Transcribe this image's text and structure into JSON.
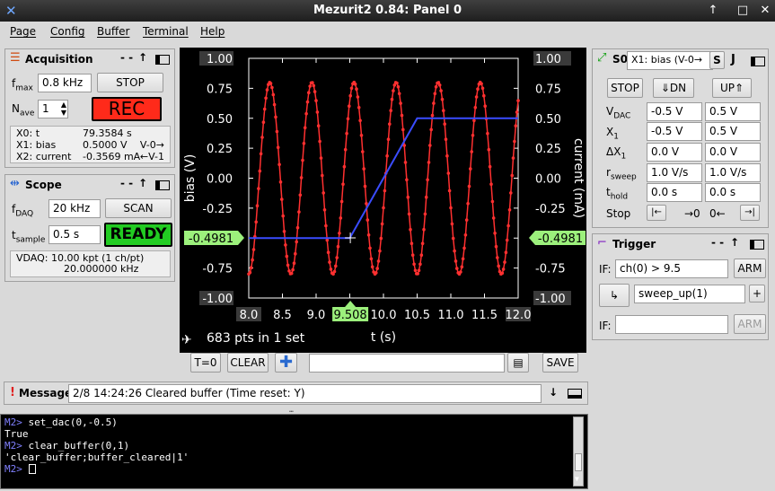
{
  "window": {
    "title": "Mezurit2 0.84: Panel 0",
    "controls": [
      "↑",
      "□",
      "✕"
    ]
  },
  "menu": [
    "Page",
    "Config",
    "Buffer",
    "Terminal",
    "Help"
  ],
  "acquisition": {
    "title": "Acquisition",
    "fmax_label": "f",
    "fmax_sub": "max",
    "fmax_value": "0.8 kHz",
    "stop_label": "STOP",
    "nave_label": "N",
    "nave_sub": "ave",
    "nave_value": "1",
    "rec_label": "REC",
    "info": [
      {
        "name": "X0: t",
        "value": "79.3584 s",
        "extra": ""
      },
      {
        "name": "X1: bias",
        "value": "0.5000 V",
        "extra": "V-0→"
      },
      {
        "name": "X2: current",
        "value": "-0.3569 mA",
        "extra": "←V-1"
      }
    ]
  },
  "scope": {
    "title": "Scope",
    "fdaq_label": "f",
    "fdaq_sub": "DAQ",
    "fdaq_value": "20 kHz",
    "scan_label": "SCAN",
    "tsample_label": "t",
    "tsample_sub": "sample",
    "tsample_value": "0.5 s",
    "ready_label": "READY",
    "info_line1": "VDAQ: 10.00 kpt (1 ch/pt)",
    "info_line2": "20.000000 kHz"
  },
  "plot": {
    "ylabel_left": "bias (V)",
    "ylabel_right": "current (mA)",
    "xlabel": "t (s)",
    "left_marker": "-0.4981",
    "right_marker": "-0.4981",
    "x_marker": "9.508",
    "status": "683 pts in 1 set",
    "colors": {
      "bias": "#ff3030",
      "current": "#3a4cff",
      "marker": "#9cf07c"
    }
  },
  "chart_data": {
    "type": "line",
    "x_ticks": [
      "8.0",
      "8.5",
      "9.0",
      "9.5",
      "10.0",
      "10.5",
      "11.0",
      "11.5",
      "12.0"
    ],
    "y_ticks": [
      "1.00",
      "0.75",
      "0.50",
      "0.25",
      "0.00",
      "-0.25",
      "-0.50",
      "-0.75",
      "-1.00"
    ],
    "xlim": [
      8.0,
      12.0
    ],
    "ylim": [
      -1.0,
      1.0
    ],
    "series": [
      {
        "name": "bias",
        "style": "dotted-sine",
        "amplitude": 0.8,
        "period": 0.625,
        "phase_x": 8.0,
        "points": 683
      },
      {
        "name": "current",
        "x": [
          8.0,
          9.5,
          10.5,
          12.0
        ],
        "y": [
          -0.5,
          -0.5,
          0.5,
          0.5
        ]
      }
    ]
  },
  "plot_buttons": {
    "t0": "T=0",
    "clear": "CLEAR",
    "save": "SAVE"
  },
  "message": {
    "label": "Message",
    "text": "2/8 14:24:26  Cleared buffer (Time reset: Y)"
  },
  "terminal": [
    {
      "prompt": "M2>",
      "text": " set_dac(0,-0.5)"
    },
    {
      "prompt": "",
      "text": "True"
    },
    {
      "prompt": "M2>",
      "text": " clear_buffer(0,1)"
    },
    {
      "prompt": "",
      "text": "'clear_buffer;buffer_cleared|1'"
    },
    {
      "prompt": "M2>",
      "text": " "
    }
  ],
  "sweep": {
    "title": "S0",
    "channel": "X1: bias (V-0→",
    "s_label": "S",
    "j_label": "J",
    "stop_label": "STOP",
    "dn_label": "DN",
    "up_label": "UP",
    "rows": [
      {
        "label": "V",
        "sub": "DAC",
        "a": "-0.5 V",
        "b": "0.5 V"
      },
      {
        "label": "X",
        "sub": "1",
        "a": "-0.5 V",
        "b": "0.5 V"
      },
      {
        "label": "ΔX",
        "sub": "1",
        "a": "0.0 V",
        "b": "0.0 V"
      },
      {
        "label": "r",
        "sub": "sweep",
        "a": "1.0 V/s",
        "b": "1.0 V/s"
      },
      {
        "label": "t",
        "sub": "hold",
        "a": "0.0 s",
        "b": "0.0 s"
      }
    ],
    "stop_row_label": "Stop",
    "stop_arrow1": "→0",
    "stop_arrow2": "0←"
  },
  "trigger": {
    "title": "Trigger",
    "if_label": "IF:",
    "if_value": "ch(0) > 9.5",
    "arm_label": "ARM",
    "action_value": "sweep_up(1)",
    "plus_label": "+",
    "if2_label": "IF:",
    "if2_value": "",
    "arm2_label": "ARM"
  }
}
